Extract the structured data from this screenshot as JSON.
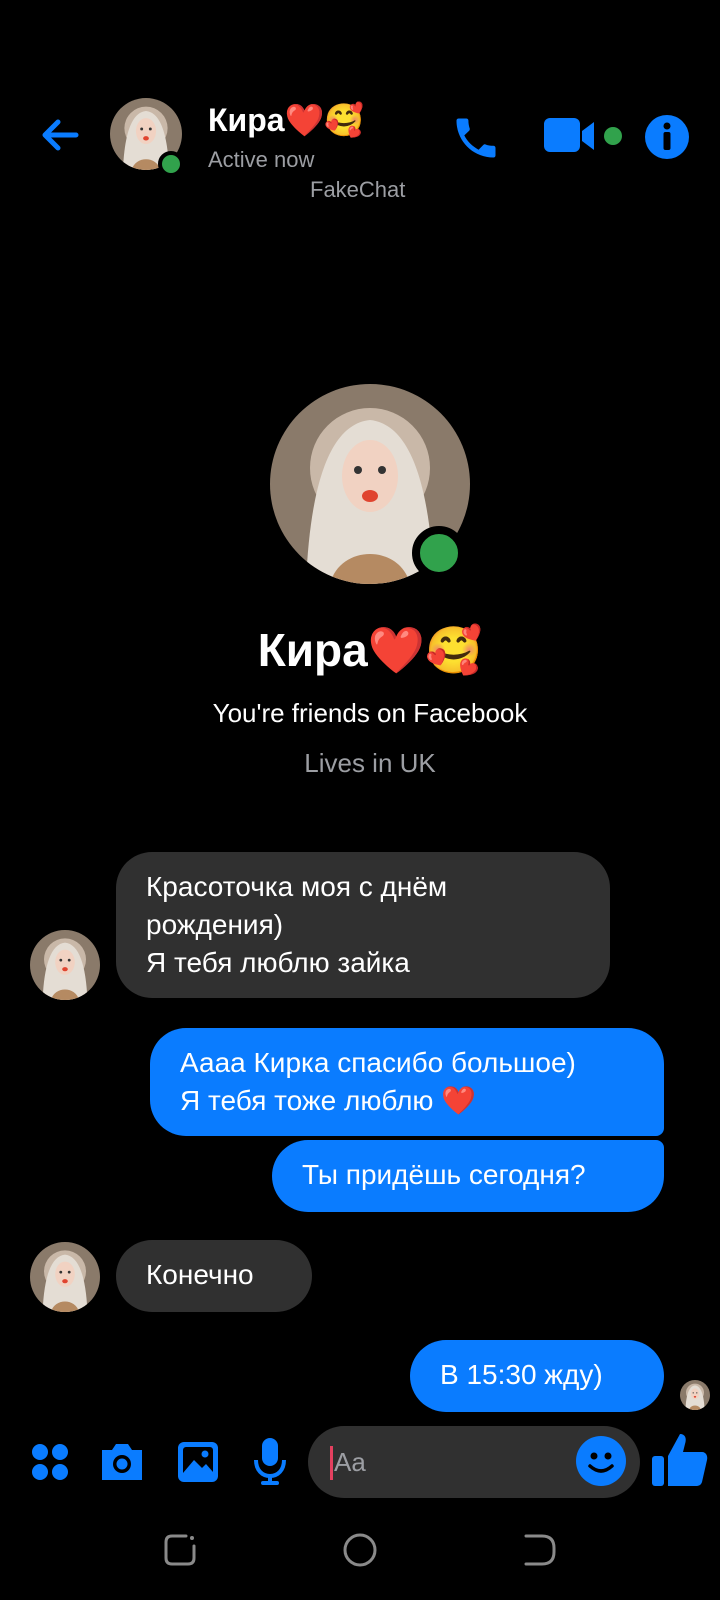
{
  "header": {
    "name": "Кира❤️🥰",
    "status": "Active now",
    "watermark": "FakeChat"
  },
  "profile": {
    "name": "Кира❤️🥰",
    "friends_text": "You're friends on Facebook",
    "lives_text": "Lives in UK"
  },
  "messages": [
    {
      "from": "contact",
      "lines": [
        "Красоточка моя с днём",
        "рождения)",
        "Я тебя люблю зайка"
      ]
    },
    {
      "from": "me",
      "lines": [
        "Аааа Кирка спасибо большое)",
        "Я тебя тоже люблю ❤️"
      ]
    },
    {
      "from": "me",
      "lines": [
        "Ты придёшь сегодня?"
      ]
    },
    {
      "from": "contact",
      "lines": [
        "Конечно"
      ]
    },
    {
      "from": "me",
      "lines": [
        "В 15:30 жду)"
      ]
    }
  ],
  "composer": {
    "placeholder": "Aa"
  },
  "colors": {
    "accent": "#0a7cff",
    "online": "#31a24c",
    "incoming_bubble": "#303030",
    "secondary_text": "#9c9ea3"
  },
  "icons": {
    "back": "arrow-left-icon",
    "call": "phone-icon",
    "video": "video-camera-icon",
    "info": "info-icon",
    "apps": "grid-dots-icon",
    "camera": "camera-icon",
    "gallery": "image-icon",
    "mic": "microphone-icon",
    "emoji": "smiley-icon",
    "like": "thumbs-up-icon"
  }
}
